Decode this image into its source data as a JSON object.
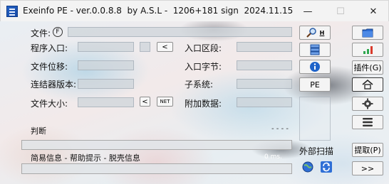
{
  "window": {
    "title": "Exeinfo PE - ver.0.0.8.8  by A.S.L -  1206+181 sign  2024.11.15",
    "minimize": "—",
    "maximize": "☐",
    "close": "✕"
  },
  "fields": {
    "file_label": "文件:",
    "file_hotkey": "F",
    "entry_point": "程序入口:",
    "entry_btn": "<",
    "file_offset": "文件位移:",
    "linker_version": "连结器版本:",
    "file_size": "文件大小:",
    "file_size_btn": "<",
    "net_btn": "NET",
    "ep_section": "入口区段:",
    "first_bytes": "入口字节:",
    "subsystem": "子系统:",
    "overlay": "附加数据:"
  },
  "toolbar": {
    "search_hotkey": "H",
    "pe_label": "PE",
    "plugins_label": "插件(G)",
    "external_scan": "外部扫描",
    "extract_label": "提取(P)",
    "next_label": ">>"
  },
  "analysis": {
    "verdict_label": "判断",
    "verdict_value": "- - - -",
    "info_label": "简易信息 - 帮助提示 - 脱壳信息",
    "time_value": "0 ms."
  },
  "colors": {
    "folder_blue": "#2f6fd6",
    "info_blue": "#1e63c9",
    "signal_green": "#2fa84f",
    "signal_red": "#d93a2b"
  }
}
